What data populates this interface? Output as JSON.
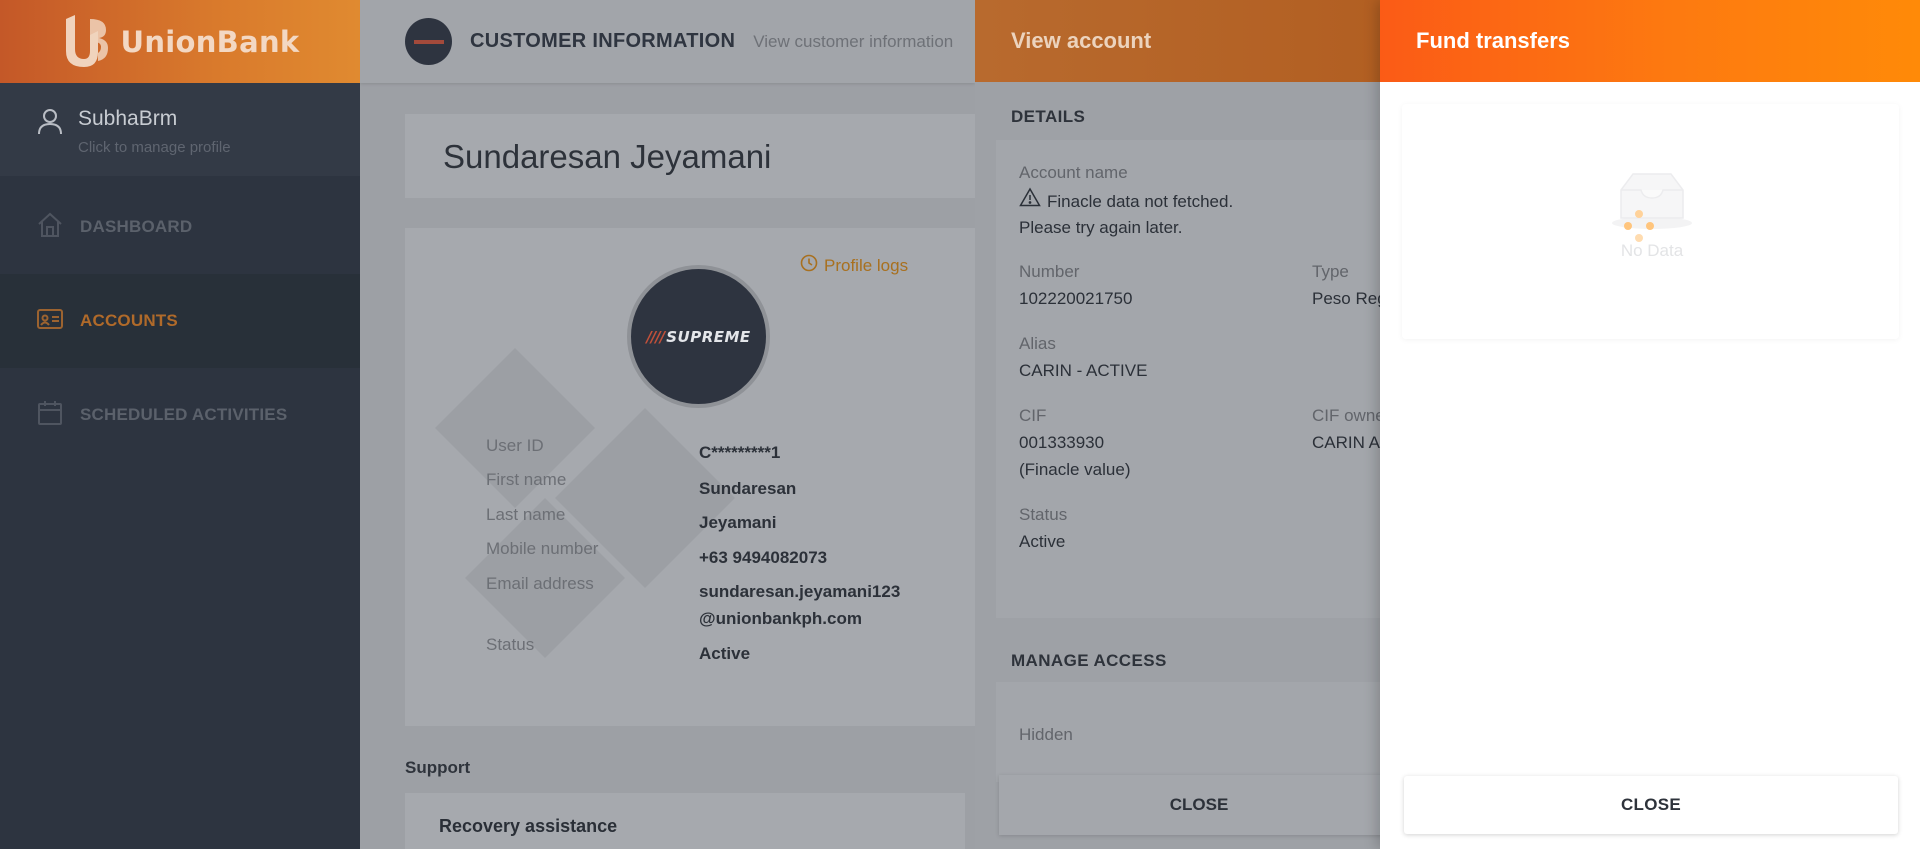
{
  "brand": {
    "name": "UnionBank"
  },
  "sidebar": {
    "profile": {
      "name": "SubhaBrm",
      "hint": "Click to manage profile"
    },
    "items": [
      {
        "label": "DASHBOARD",
        "icon": "home-icon",
        "active": false
      },
      {
        "label": "ACCOUNTS",
        "icon": "id-card-icon",
        "active": true
      },
      {
        "label": "SCHEDULED ACTIVITIES",
        "icon": "calendar-icon",
        "active": false
      }
    ]
  },
  "main": {
    "header": {
      "title": "CUSTOMER INFORMATION",
      "subtitle": "View customer information"
    },
    "customer_name": "Sundaresan Jeyamani",
    "profile_logs": "Profile logs",
    "avatar_text": "SUPREME",
    "fields": [
      {
        "label": "User ID",
        "value": "C*********1"
      },
      {
        "label": "First name",
        "value": "Sundaresan"
      },
      {
        "label": "Last name",
        "value": "Jeyamani"
      },
      {
        "label": "Mobile number",
        "value": "+63 9494082073"
      },
      {
        "label": "Email address",
        "value": "sundaresan.jeyamani123",
        "value2": "@unionbankph.com"
      },
      {
        "label": "Status",
        "value": "Active"
      }
    ],
    "support": {
      "title": "Support",
      "card_title": "Recovery assistance"
    }
  },
  "view_account": {
    "title": "View account",
    "details_title": "DETAILS",
    "account_name_label": "Account name",
    "account_name_warning_1": "Finacle data not fetched.",
    "account_name_warning_2": "Please try again later.",
    "number_label": "Number",
    "number_value": "102220021750",
    "type_label": "Type",
    "type_value": "Peso Reg",
    "alias_label": "Alias",
    "alias_value": "CARIN - ACTIVE",
    "cif_label": "CIF",
    "cif_value": "001333930",
    "cif_note": "(Finacle value)",
    "cif_owner_label": "CIF owne",
    "cif_owner_value": "CARIN A",
    "status_label": "Status",
    "status_value": "Active",
    "manage_title": "MANAGE ACCESS",
    "hidden_label": "Hidden",
    "close_label": "CLOSE"
  },
  "fund_transfers": {
    "title": "Fund transfers",
    "empty_text": "No Data",
    "close_label": "CLOSE"
  },
  "colors": {
    "accent": "#ff7a0d",
    "sidebar_bg": "#2d3440",
    "active_nav": "#b06a2a"
  }
}
